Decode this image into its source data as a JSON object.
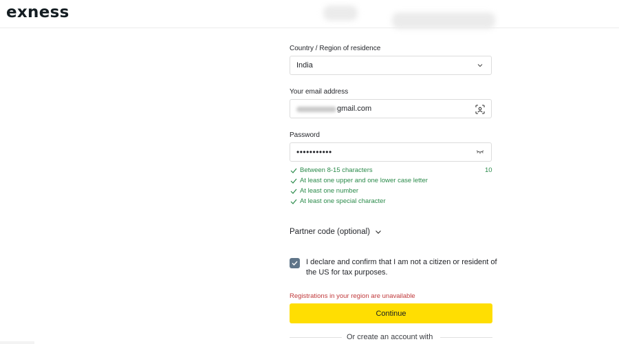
{
  "header": {
    "logo": "exness"
  },
  "form": {
    "country": {
      "label": "Country / Region of residence",
      "value": "India"
    },
    "email": {
      "label": "Your email address",
      "domain": "gmail.com"
    },
    "password": {
      "label": "Password",
      "value": "•••••••••••"
    },
    "requirements": [
      {
        "text": "Between 8-15 characters",
        "met": true
      },
      {
        "text": "At least one upper and one lower case letter",
        "met": true
      },
      {
        "text": "At least one number",
        "met": true
      },
      {
        "text": "At least one special character",
        "met": true
      }
    ],
    "char_count": "10",
    "partner_code": "Partner code (optional)",
    "declaration": {
      "text": "I declare and confirm that I am not a citizen or resident of the US for tax purposes.",
      "checked": true
    },
    "error": "Registrations in your region are unavailable",
    "continue_label": "Continue",
    "alt_signup": "Or create an account with"
  },
  "colors": {
    "accent": "#ffde02",
    "success": "#2a8a4a",
    "error": "#c0393b",
    "checkbox": "#5f7589"
  }
}
